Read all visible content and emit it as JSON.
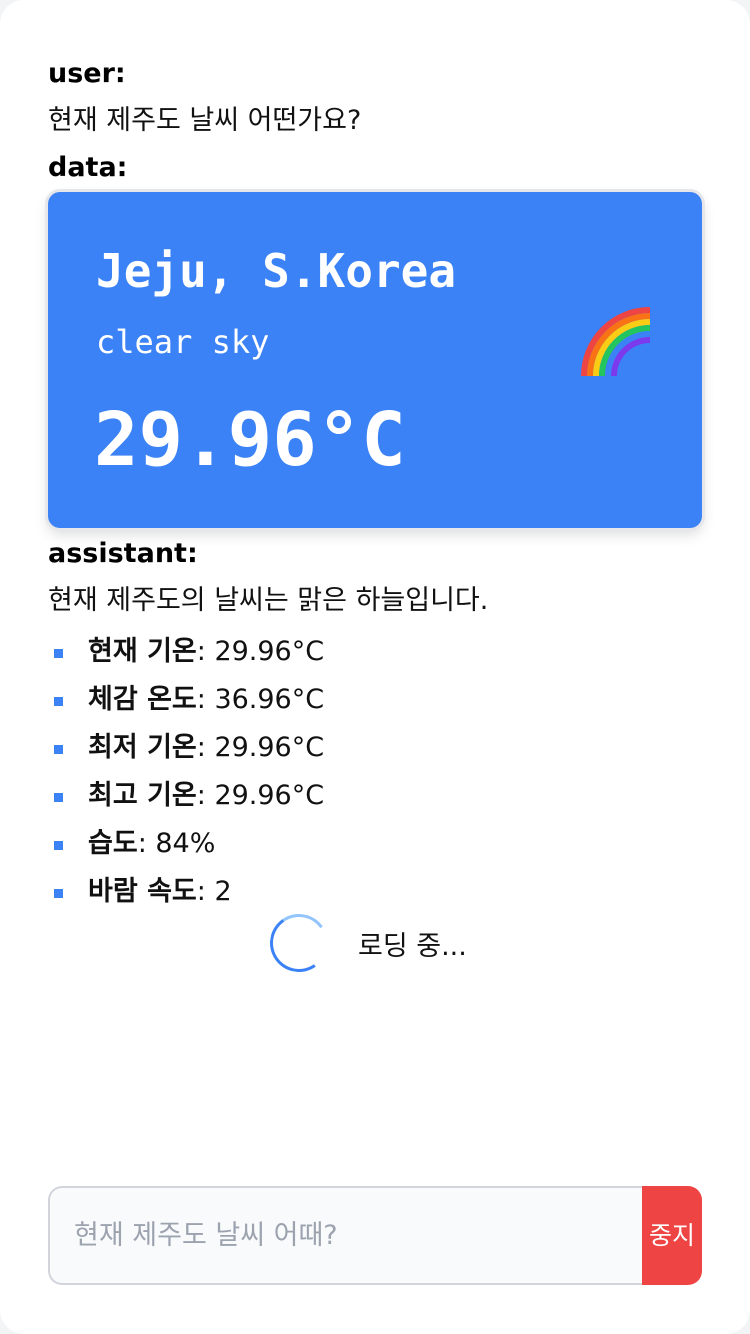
{
  "messages": {
    "user_role": "user:",
    "user_text": "현재 제주도 날씨 어떤가요?",
    "data_role": "data:",
    "assistant_role": "assistant:",
    "assistant_text": "현재 제주도의 날씨는 맑은 하늘입니다."
  },
  "weather_card": {
    "city": "Jeju, S.Korea",
    "description": "clear sky",
    "temperature": "29.96°C",
    "icon": "rainbow-icon",
    "background_color": "#3b82f6"
  },
  "details": [
    {
      "label": "현재 기온",
      "value": ": 29.96°C"
    },
    {
      "label": "체감 온도",
      "value": ": 36.96°C"
    },
    {
      "label": "최저 기온",
      "value": ": 29.96°C"
    },
    {
      "label": "최고 기온",
      "value": ": 29.96°C"
    },
    {
      "label": "습도",
      "value": ": 84%"
    },
    {
      "label": "바람 속도",
      "value": ": 2"
    }
  ],
  "loading": {
    "text": "로딩 중..."
  },
  "composer": {
    "placeholder": "현재 제주도 날씨 어때?",
    "value": "",
    "stop_label": "중지",
    "stop_color": "#ef4444"
  },
  "accent_color": "#3b82f6"
}
